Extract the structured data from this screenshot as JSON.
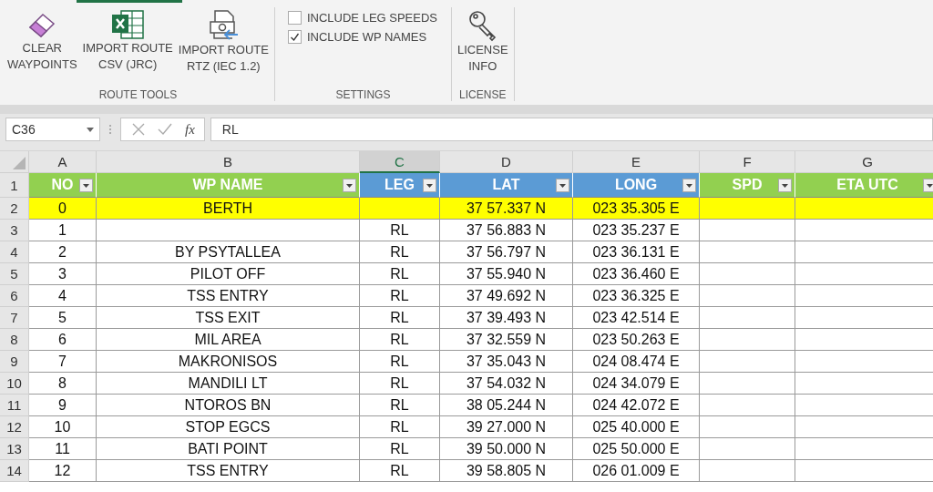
{
  "ribbon": {
    "groups": [
      {
        "label": "ROUTE TOOLS",
        "buttons": [
          {
            "label": "CLEAR\nWAYPOINTS",
            "kind": "eraser"
          },
          {
            "label": "IMPORT ROUTE\nCSV (JRC)",
            "kind": "spreadsheet"
          },
          {
            "label": "IMPORT ROUTE\nRTZ (IEC 1.2)",
            "kind": "document"
          }
        ]
      },
      {
        "label": "SETTINGS",
        "checkboxes": [
          {
            "label": "INCLUDE LEG SPEEDS",
            "checked": false
          },
          {
            "label": "INCLUDE WP NAMES",
            "checked": true
          }
        ]
      },
      {
        "label": "LICENSE",
        "buttons": [
          {
            "label": "LICENSE\nINFO",
            "kind": "key"
          }
        ]
      }
    ]
  },
  "formula_bar": {
    "name_box": "C36",
    "function_label": "fx",
    "formula": "RL"
  },
  "sheet": {
    "columns": [
      {
        "letter": "A",
        "selected": false,
        "label": "NO",
        "color": "#92d050"
      },
      {
        "letter": "B",
        "selected": false,
        "label": "WP NAME",
        "color": "#92d050"
      },
      {
        "letter": "C",
        "selected": true,
        "label": "LEG",
        "color": "#5b9bd5"
      },
      {
        "letter": "D",
        "selected": false,
        "label": "LAT",
        "color": "#5b9bd5"
      },
      {
        "letter": "E",
        "selected": false,
        "label": "LONG",
        "color": "#5b9bd5"
      },
      {
        "letter": "F",
        "selected": false,
        "label": "SPD",
        "color": "#92d050"
      },
      {
        "letter": "G",
        "selected": false,
        "label": "ETA UTC",
        "color": "#92d050"
      }
    ],
    "header_row": "1",
    "rows": [
      {
        "number": "2",
        "highlighted": true,
        "cells": [
          "0",
          "BERTH",
          "",
          "37 57.337 N",
          "023 35.305 E",
          "",
          ""
        ]
      },
      {
        "number": "3",
        "highlighted": false,
        "cells": [
          "1",
          "",
          "RL",
          "37 56.883 N",
          "023 35.237 E",
          "",
          ""
        ]
      },
      {
        "number": "4",
        "highlighted": false,
        "cells": [
          "2",
          "BY PSYTALLEA",
          "RL",
          "37 56.797 N",
          "023 36.131 E",
          "",
          ""
        ]
      },
      {
        "number": "5",
        "highlighted": false,
        "cells": [
          "3",
          "PILOT OFF",
          "RL",
          "37 55.940 N",
          "023 36.460 E",
          "",
          ""
        ]
      },
      {
        "number": "6",
        "highlighted": false,
        "cells": [
          "4",
          "TSS ENTRY",
          "RL",
          "37 49.692 N",
          "023 36.325 E",
          "",
          ""
        ]
      },
      {
        "number": "7",
        "highlighted": false,
        "cells": [
          "5",
          "TSS EXIT",
          "RL",
          "37 39.493 N",
          "023 42.514 E",
          "",
          ""
        ]
      },
      {
        "number": "8",
        "highlighted": false,
        "cells": [
          "6",
          "MIL AREA",
          "RL",
          "37 32.559 N",
          "023 50.263 E",
          "",
          ""
        ]
      },
      {
        "number": "9",
        "highlighted": false,
        "cells": [
          "7",
          "MAKRONISOS",
          "RL",
          "37 35.043 N",
          "024 08.474 E",
          "",
          ""
        ]
      },
      {
        "number": "10",
        "highlighted": false,
        "cells": [
          "8",
          "MANDILI LT",
          "RL",
          "37 54.032 N",
          "024 34.079 E",
          "",
          ""
        ]
      },
      {
        "number": "11",
        "highlighted": false,
        "cells": [
          "9",
          "NTOROS BN",
          "RL",
          "38 05.244 N",
          "024 42.072 E",
          "",
          ""
        ]
      },
      {
        "number": "12",
        "highlighted": false,
        "cells": [
          "10",
          "STOP EGCS",
          "RL",
          "39 27.000 N",
          "025 40.000 E",
          "",
          ""
        ]
      },
      {
        "number": "13",
        "highlighted": false,
        "cells": [
          "11",
          "BATI POINT",
          "RL",
          "39 50.000 N",
          "025 50.000 E",
          "",
          ""
        ]
      },
      {
        "number": "14",
        "highlighted": false,
        "cells": [
          "12",
          "TSS ENTRY",
          "RL",
          "39 58.805 N",
          "026 01.009 E",
          "",
          ""
        ]
      }
    ]
  }
}
